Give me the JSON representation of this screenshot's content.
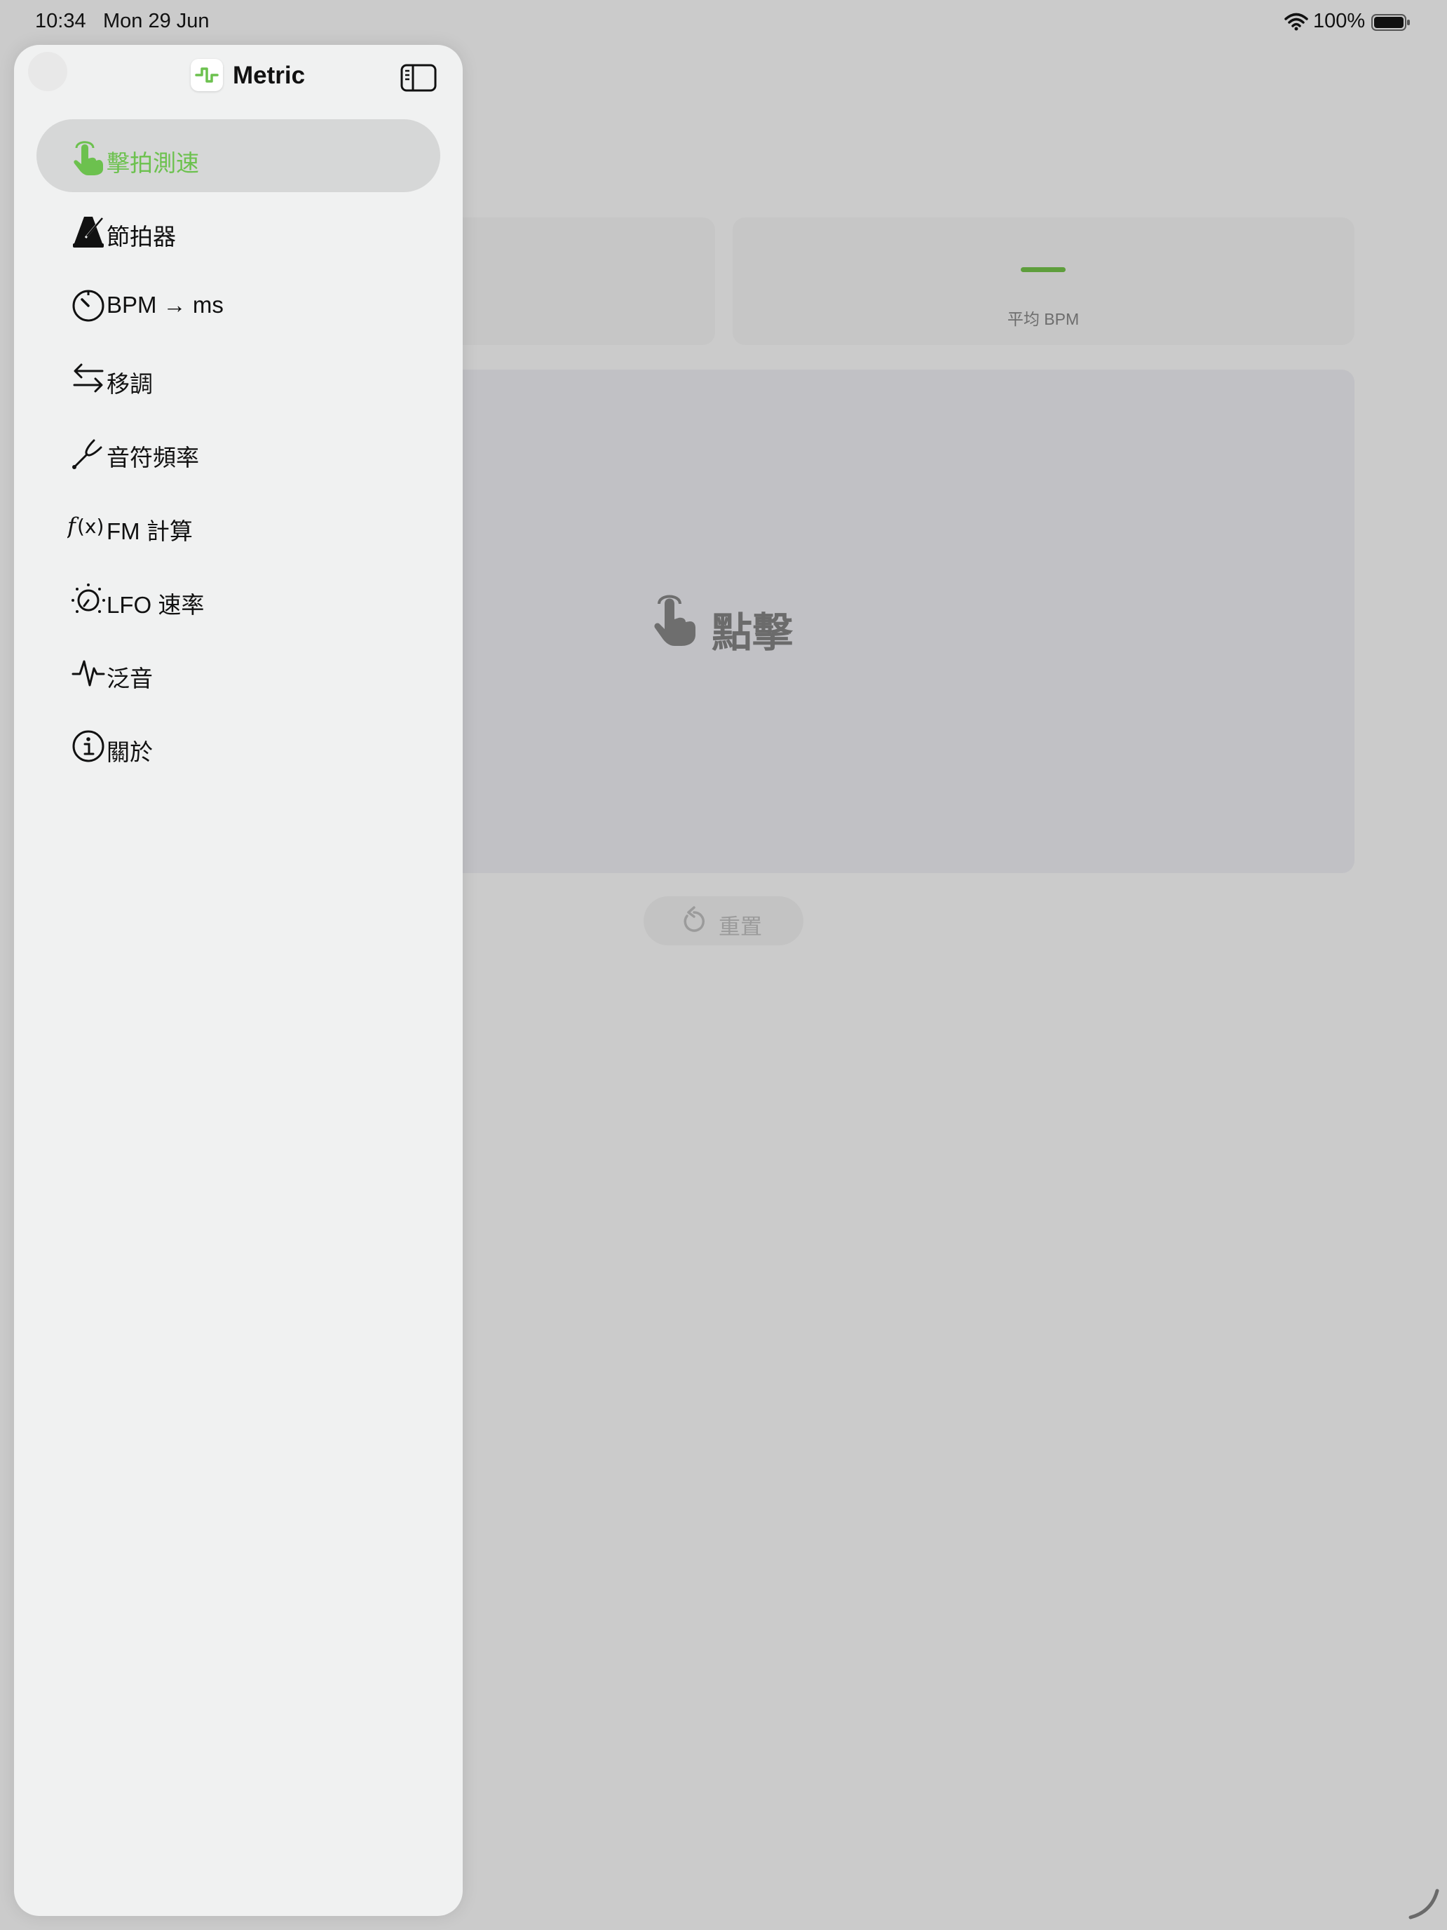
{
  "status_bar": {
    "time": "10:34",
    "date": "Mon 29 Jun",
    "battery_pct": "100%",
    "icons": [
      "wifi-icon",
      "battery-icon"
    ]
  },
  "sidebar": {
    "app_title": "Metric",
    "app_icon": "metric-logo-icon",
    "toggle_icon": "sidebar-toggle-icon",
    "selected_index": 0,
    "items": [
      {
        "label": "擊拍測速",
        "icon": "tap-hand-icon"
      },
      {
        "label": "節拍器",
        "icon": "metronome-icon"
      },
      {
        "label": "BPM → ms",
        "icon": "timer-icon"
      },
      {
        "label": "移調",
        "icon": "transpose-arrows-icon"
      },
      {
        "label": "音符頻率",
        "icon": "tuning-fork-icon"
      },
      {
        "label": "FM 計算",
        "icon": "function-icon"
      },
      {
        "label": "LFO 速率",
        "icon": "lfo-dial-icon"
      },
      {
        "label": "泛音",
        "icon": "waveform-icon"
      },
      {
        "label": "關於",
        "icon": "info-icon"
      }
    ]
  },
  "main": {
    "avg_bpm_value": "—",
    "avg_bpm_label": "平均 BPM",
    "tap_area_label": "點擊",
    "reset_label": "重置",
    "accent_color": "#5e9e3c"
  }
}
